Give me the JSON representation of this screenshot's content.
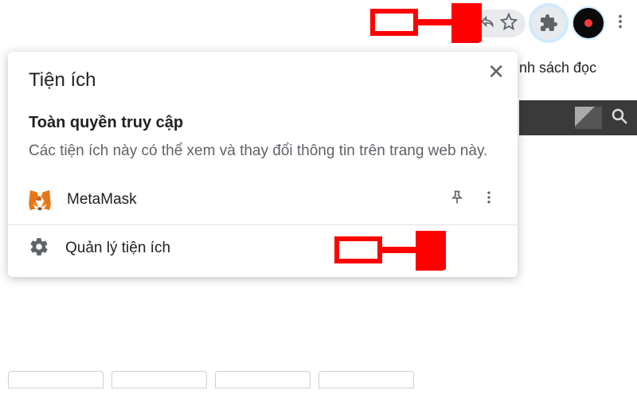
{
  "side_label": "nh sách đọc",
  "popup": {
    "title": "Tiện ích",
    "subtitle": "Toàn quyền truy cập",
    "description": "Các tiện ích này có thể xem và thay đổi thông tin trên trang web này.",
    "extensions": [
      {
        "name": "MetaMask",
        "icon": "fox"
      }
    ],
    "manage_label": "Quản lý tiện ích"
  }
}
